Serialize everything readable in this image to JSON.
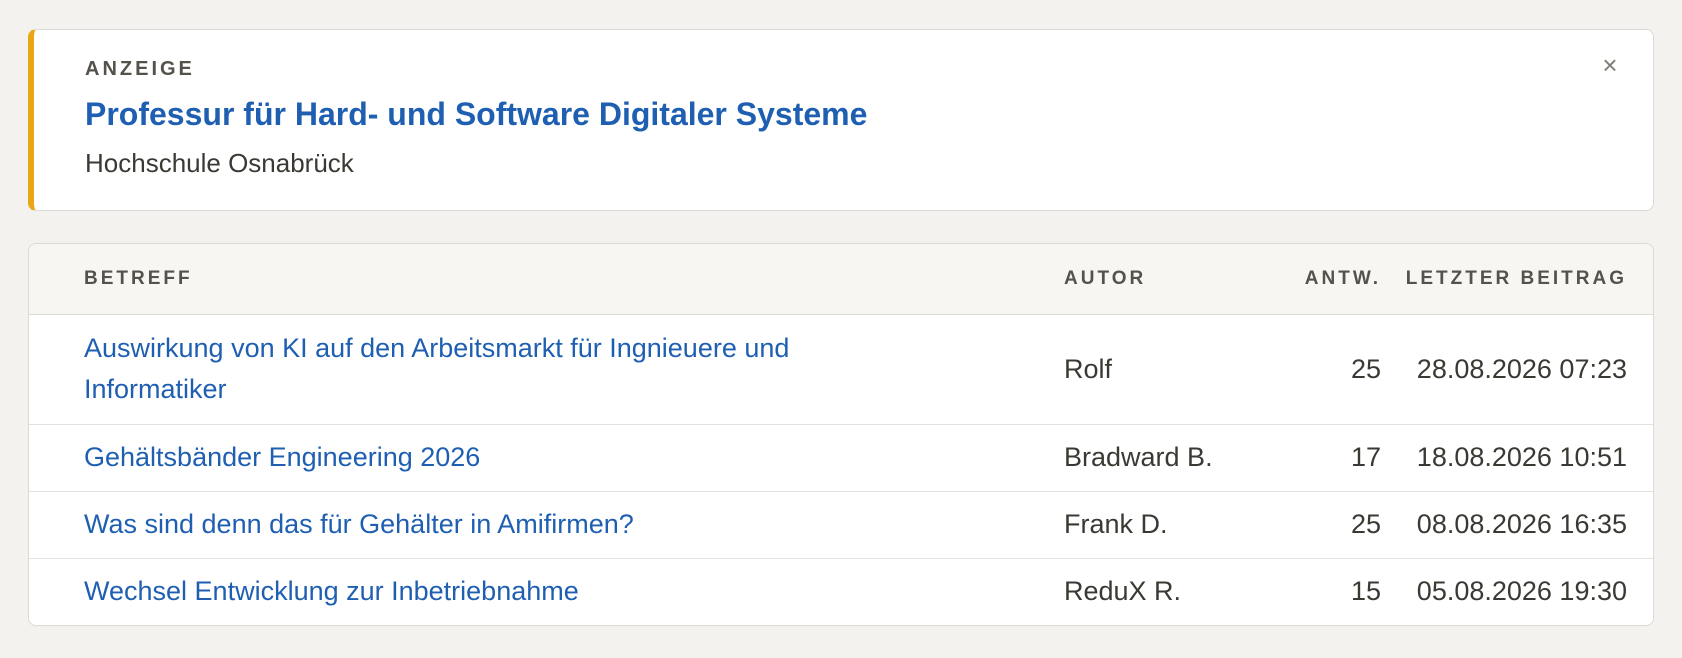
{
  "ad": {
    "label": "ANZEIGE",
    "title": "Professur für Hard- und Software Digitaler Systeme",
    "company": "Hochschule Osnabrück",
    "close_label": "×",
    "accent_color": "#e9a716"
  },
  "table": {
    "headers": {
      "subject": "BETREFF",
      "author": "AUTOR",
      "replies": "ANTW.",
      "last_post": "LETZTER BEITRAG"
    },
    "rows": [
      {
        "subject": "Auswirkung von KI auf den Arbeitsmarkt für Ingnieuere und Informatiker",
        "author": "Rolf",
        "replies": "25",
        "last_post": "28.08.2026 07:23"
      },
      {
        "subject": "Gehältsbänder Engineering 2026",
        "author": "Bradward B.",
        "replies": "17",
        "last_post": "18.08.2026 10:51"
      },
      {
        "subject": "Was sind denn das für Gehälter in Amifirmen?",
        "author": "Frank D.",
        "replies": "25",
        "last_post": "08.08.2026 16:35"
      },
      {
        "subject": "Wechsel Entwicklung zur Inbetriebnahme",
        "author": "ReduX R.",
        "replies": "15",
        "last_post": "05.08.2026 19:30"
      }
    ]
  },
  "colors": {
    "link": "#1f5fb2",
    "background": "#f3f2ee",
    "card": "#ffffff"
  }
}
